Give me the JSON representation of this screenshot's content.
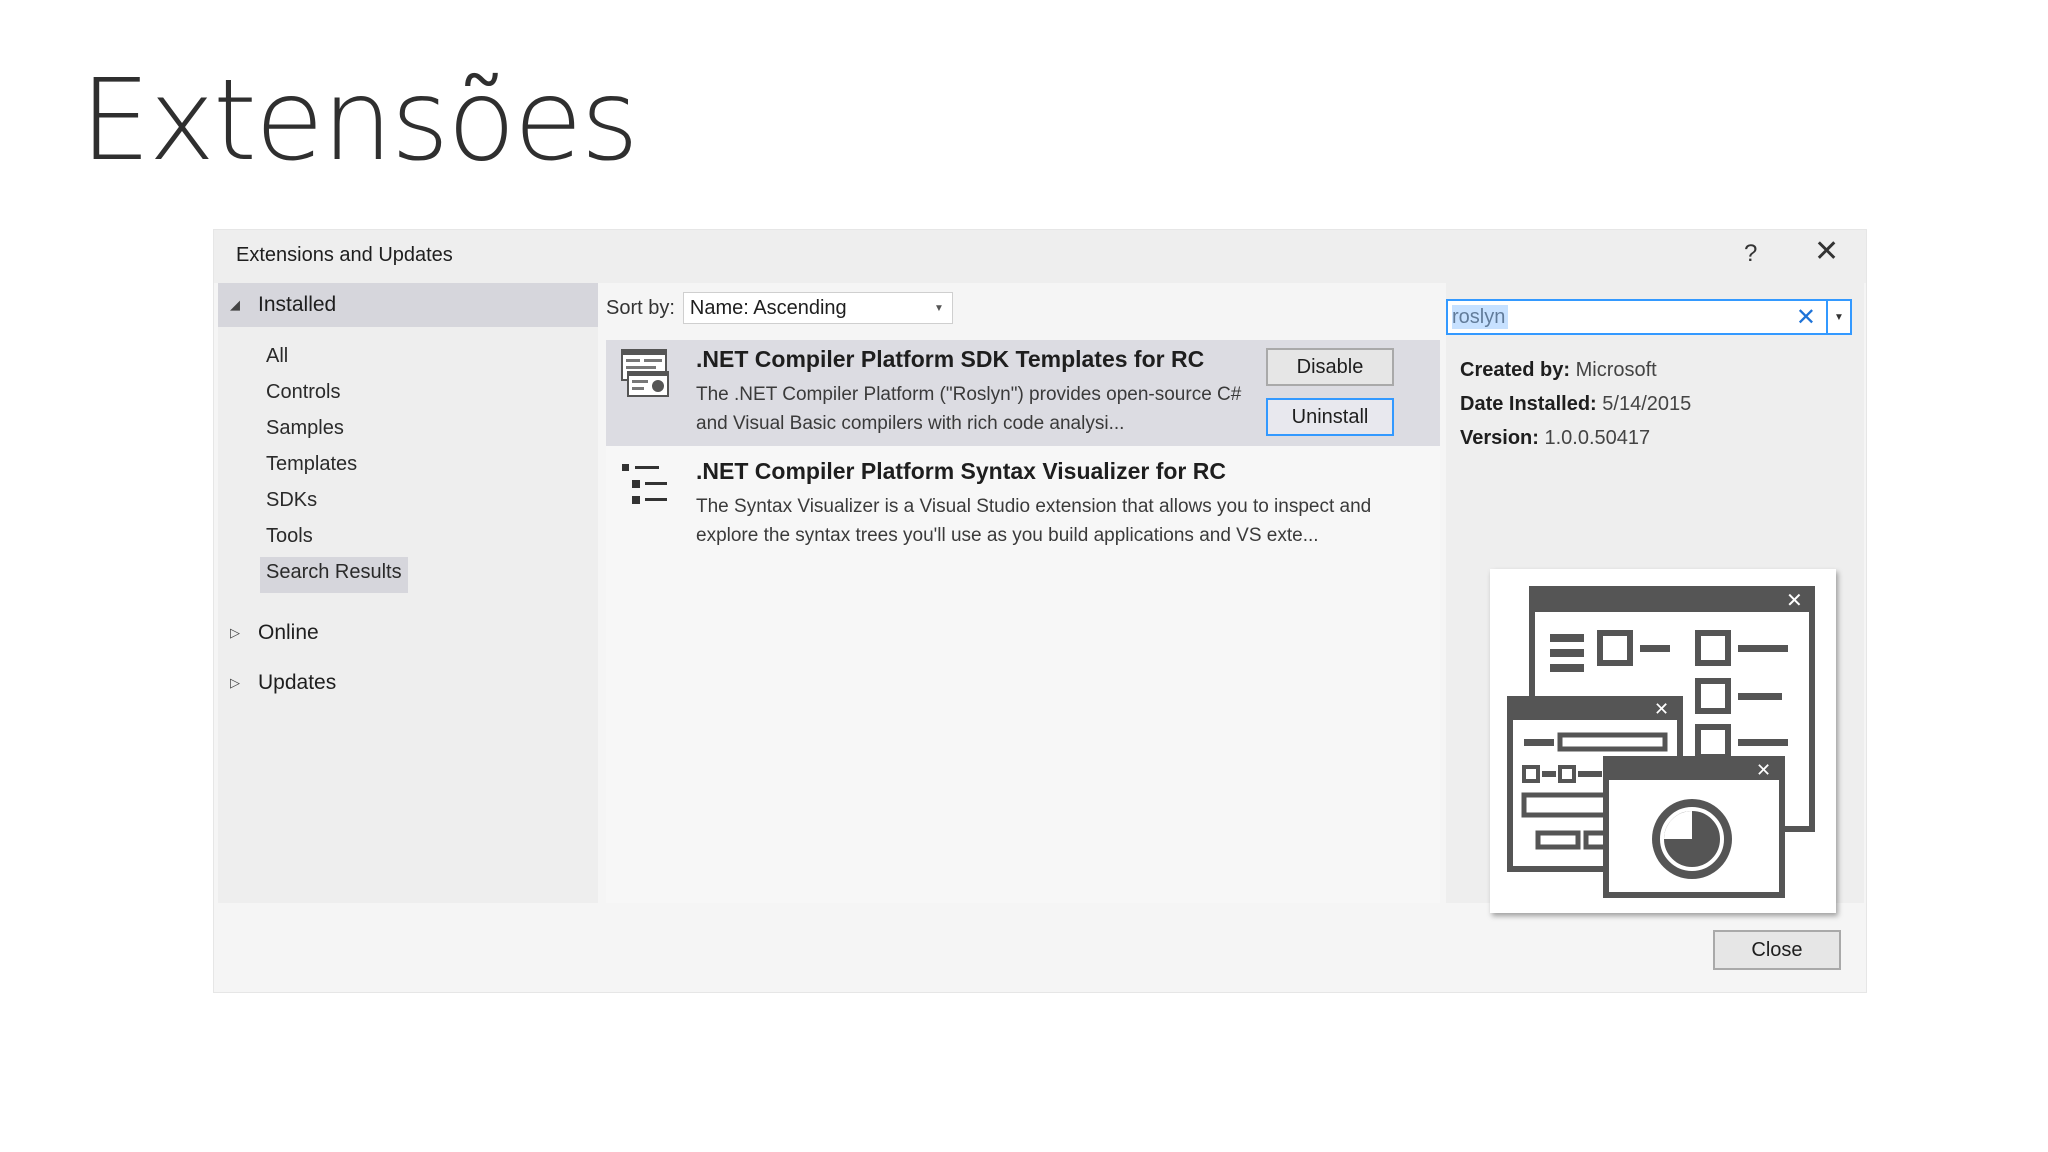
{
  "slide": {
    "title": "Extensões"
  },
  "dialog": {
    "title": "Extensions and Updates",
    "help_label": "?",
    "close_glyph": "✕",
    "close_button_label": "Close"
  },
  "nav": {
    "installed": "Installed",
    "items": [
      "All",
      "Controls",
      "Samples",
      "Templates",
      "SDKs",
      "Tools",
      "Search Results"
    ],
    "selected_item": "Search Results",
    "online": "Online",
    "updates": "Updates"
  },
  "sort": {
    "label": "Sort by:",
    "value": "Name: Ascending"
  },
  "search": {
    "value": "roslyn"
  },
  "results": [
    {
      "title": ".NET Compiler Platform SDK Templates for RC",
      "description": "The .NET Compiler Platform (\"Roslyn\") provides open-source C# and Visual Basic compilers with rich code analysi...",
      "disable_label": "Disable",
      "uninstall_label": "Uninstall"
    },
    {
      "title": ".NET Compiler Platform Syntax Visualizer for RC",
      "description": "The Syntax Visualizer is a Visual Studio extension that allows you to inspect and explore the syntax trees you'll use as you build applications and VS exte..."
    }
  ],
  "details": {
    "created_by_label": "Created by:",
    "created_by": "Microsoft",
    "date_label": "Date Installed:",
    "date": "5/14/2015",
    "version_label": "Version:",
    "version": "1.0.0.50417"
  },
  "colors": {
    "accent": "#3399ff",
    "selection": "#d6d6dc",
    "icon_gray": "#555555"
  }
}
